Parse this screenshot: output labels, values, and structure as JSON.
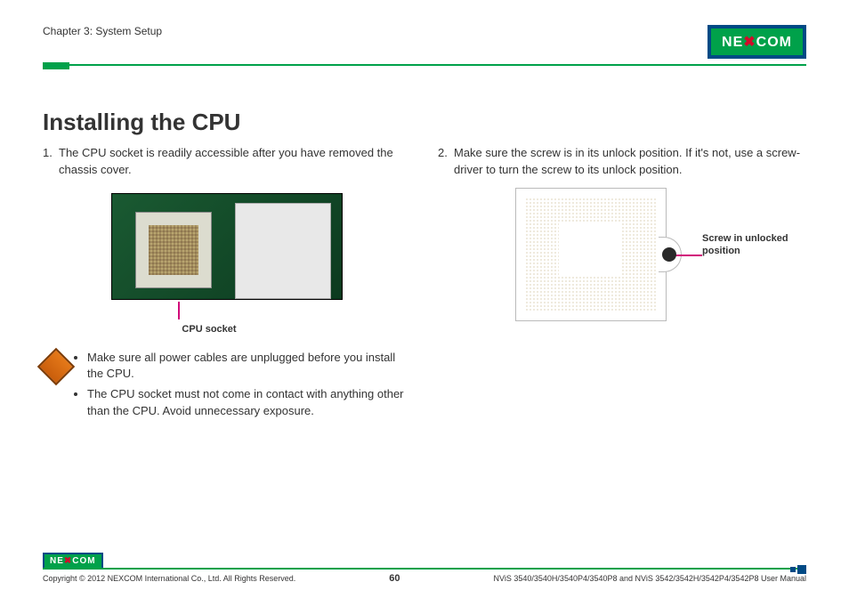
{
  "header": {
    "chapter": "Chapter 3: System Setup",
    "logo_text": "NE COM",
    "logo_x": "X"
  },
  "title": "Installing the CPU",
  "left": {
    "step_num": "1.",
    "step_text": "The CPU socket is readily accessible after you have removed the chassis cover.",
    "figure_caption": "CPU socket",
    "bullets": [
      "Make sure all power cables are unplugged before you install the CPU.",
      "The CPU socket must not come in contact with anything other than the CPU. Avoid unnecessary exposure."
    ]
  },
  "right": {
    "step_num": "2.",
    "step_text": "Make sure the screw is in its unlock position. If it's not, use a screw-driver to turn the screw to its unlock position.",
    "screw_label": "Screw in unlocked position"
  },
  "footer": {
    "copyright": "Copyright © 2012 NEXCOM International Co., Ltd. All Rights Reserved.",
    "page": "60",
    "manual": "NViS 3540/3540H/3540P4/3540P8 and NViS 3542/3542H/3542P4/3542P8 User Manual"
  }
}
